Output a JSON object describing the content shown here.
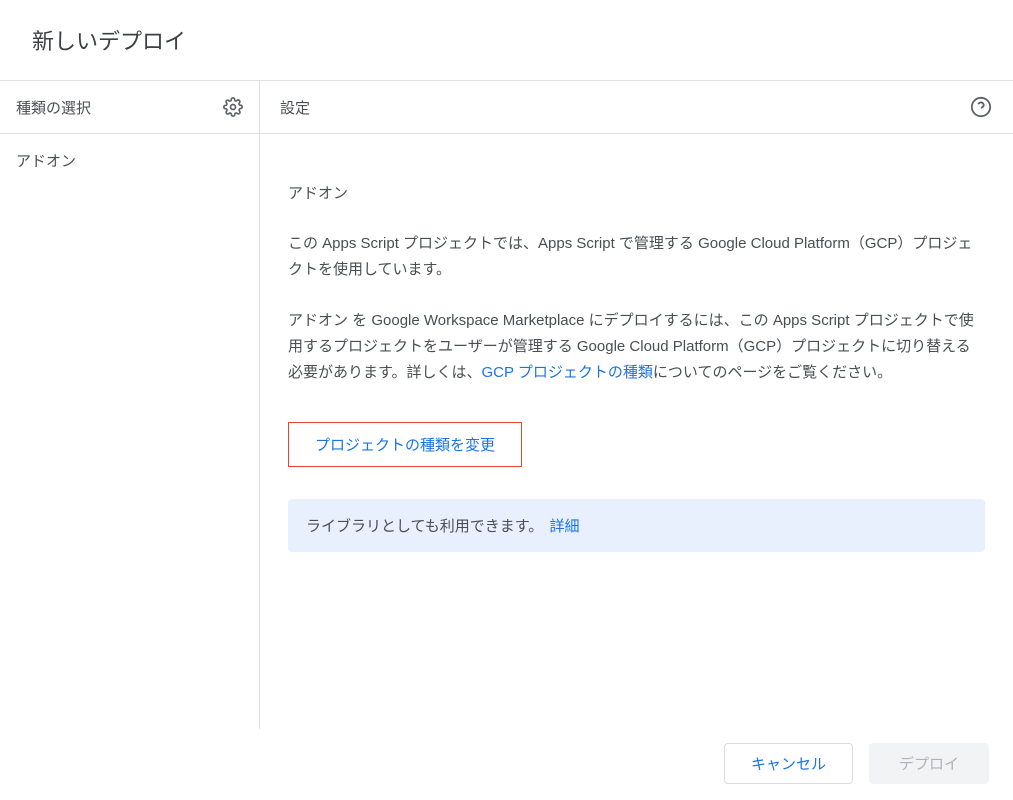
{
  "dialog": {
    "title": "新しいデプロイ"
  },
  "sidebar": {
    "header_label": "種類の選択",
    "items": [
      {
        "label": "アドオン"
      }
    ]
  },
  "main": {
    "header_label": "設定",
    "section_title": "アドオン",
    "paragraph1": "この Apps Script プロジェクトでは、Apps Script で管理する Google Cloud Platform（GCP）プロジェクトを使用しています。",
    "paragraph2_pre": "アドオン を Google Workspace Marketplace にデプロイするには、この Apps Script プロジェクトで使用するプロジェクトをユーザーが管理する Google Cloud Platform（GCP）プロジェクトに切り替える必要があります。詳しくは、",
    "paragraph2_link": "GCP プロジェクトの種類",
    "paragraph2_post": "についてのページをご覧ください。",
    "change_button_label": "プロジェクトの種類を変更",
    "info_text": "ライブラリとしても利用できます。",
    "info_link": "詳細"
  },
  "footer": {
    "cancel_label": "キャンセル",
    "deploy_label": "デプロイ"
  }
}
